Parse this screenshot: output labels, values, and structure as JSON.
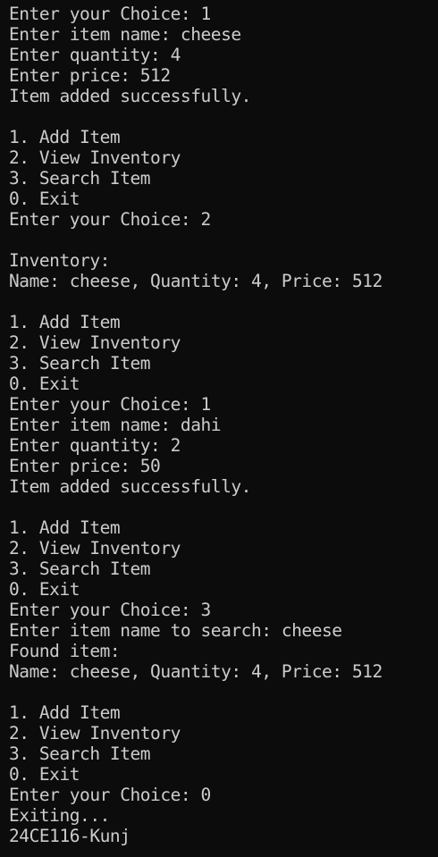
{
  "terminal": {
    "lines": [
      "Enter your Choice: 1",
      "Enter item name: cheese",
      "Enter quantity: 4",
      "Enter price: 512",
      "Item added successfully.",
      "",
      "1. Add Item",
      "2. View Inventory",
      "3. Search Item",
      "0. Exit",
      "Enter your Choice: 2",
      "",
      "Inventory:",
      "Name: cheese, Quantity: 4, Price: 512",
      "",
      "1. Add Item",
      "2. View Inventory",
      "3. Search Item",
      "0. Exit",
      "Enter your Choice: 1",
      "Enter item name: dahi",
      "Enter quantity: 2",
      "Enter price: 50",
      "Item added successfully.",
      "",
      "1. Add Item",
      "2. View Inventory",
      "3. Search Item",
      "0. Exit",
      "Enter your Choice: 3",
      "Enter item name to search: cheese",
      "Found item:",
      "Name: cheese, Quantity: 4, Price: 512",
      "",
      "1. Add Item",
      "2. View Inventory",
      "3. Search Item",
      "0. Exit",
      "Enter your Choice: 0",
      "Exiting...",
      "24CE116-Kunj"
    ]
  }
}
